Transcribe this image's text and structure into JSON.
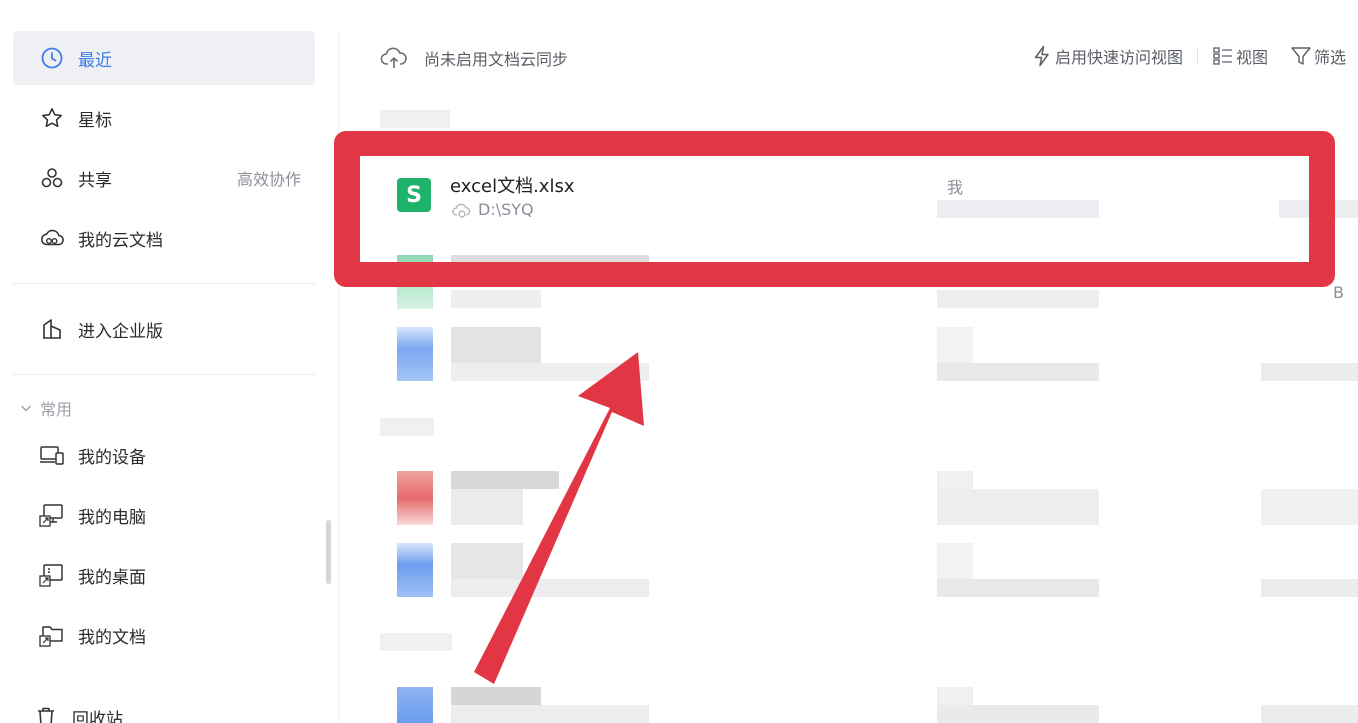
{
  "sidebar": {
    "recent": "最近",
    "starred": "星标",
    "shared": "共享",
    "shared_extra": "高效协作",
    "cloud_docs": "我的云文档",
    "enterprise": "进入企业版",
    "section_common": "常用",
    "my_devices": "我的设备",
    "my_computer": "我的电脑",
    "my_desktop": "我的桌面",
    "my_documents": "我的文档",
    "recycle_bin": "回收站"
  },
  "topbar": {
    "cloud_status": "尚未启用文档云同步",
    "quick_access": "启用快速访问视图",
    "view": "视图",
    "filter": "筛选"
  },
  "file": {
    "name": "excel文档.xlsx",
    "path": "D:\\SYQ",
    "owner": "我",
    "icon_letter": "S"
  },
  "misc": {
    "size_suffix": "B"
  },
  "colors": {
    "accent": "#3e7be8",
    "excel_green": "#1fb26b",
    "highlight_red": "#e23645"
  }
}
